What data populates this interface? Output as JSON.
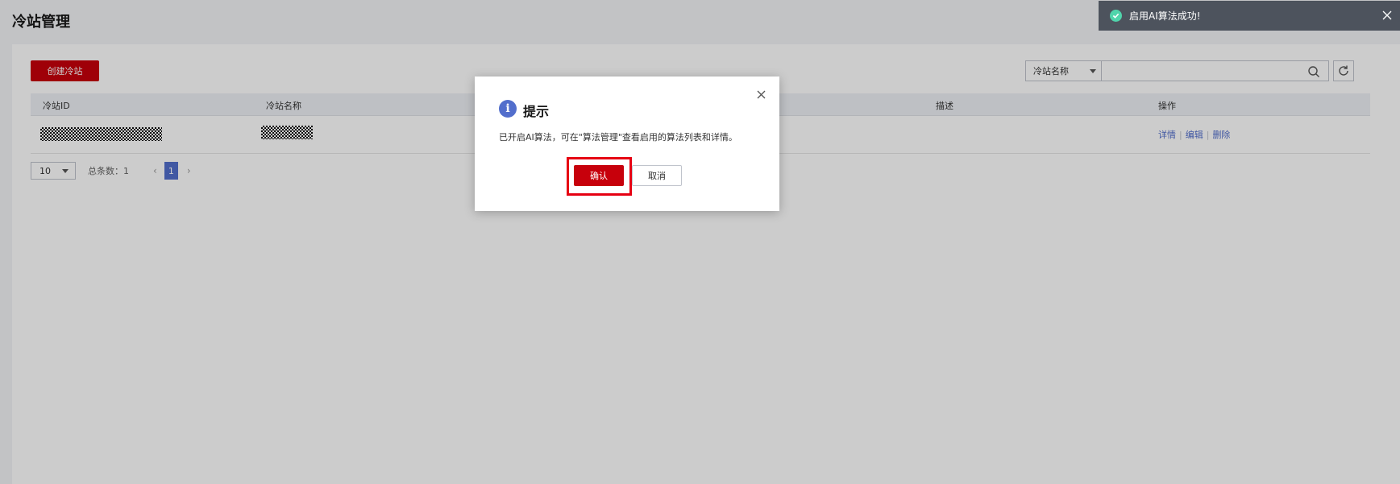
{
  "page": {
    "title": "冷站管理",
    "create_button": "创建冷站"
  },
  "search": {
    "select_value": "冷站名称",
    "input_value": ""
  },
  "table": {
    "columns": [
      "冷站ID",
      "冷站名称",
      "描述",
      "操作"
    ],
    "row_actions": [
      "详情",
      "编辑",
      "删除"
    ]
  },
  "pagination": {
    "page_size": "10",
    "total_label": "总条数：1",
    "current_page": "1",
    "prev": "‹",
    "next": "›"
  },
  "toast": {
    "message": "启用AI算法成功!"
  },
  "dialog": {
    "icon_text": "i",
    "title": "提示",
    "message": "已开启AI算法，可在\"算法管理\"查看启用的算法列表和详情。",
    "confirm_label": "确认",
    "cancel_label": "取消"
  },
  "colors": {
    "primary": "#c7000b",
    "link": "#526ecc",
    "success": "#50d4ab",
    "toast_bg": "#4d535d",
    "highlight": "#e60012"
  }
}
